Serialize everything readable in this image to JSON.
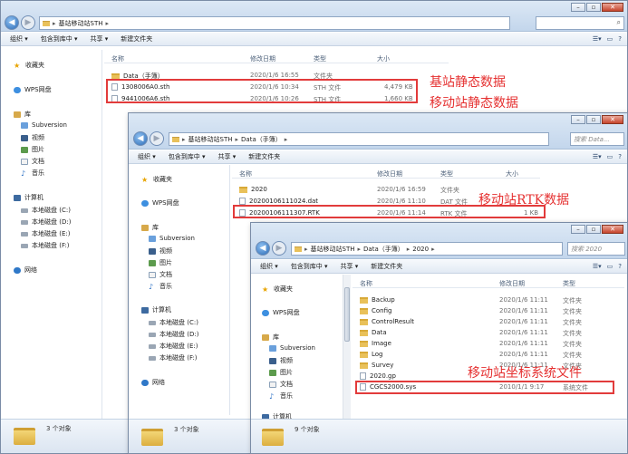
{
  "colors": {
    "annotation": "#e23b3b",
    "accent": "#2c6cb6"
  },
  "window1": {
    "address": [
      "基站移动站STH"
    ],
    "search_placeholder": "",
    "toolbar": {
      "organize": "组织 ▾",
      "include": "包含到库中 ▾",
      "share": "共享 ▾",
      "new_folder": "新建文件夹"
    },
    "columns": {
      "name": "名称",
      "modified": "修改日期",
      "type": "类型",
      "size": "大小"
    },
    "files": [
      {
        "name": "Data（手簿）",
        "date": "2020/1/6 16:55",
        "type": "文件夹",
        "size": "",
        "kind": "folder"
      },
      {
        "name": "1308006A0.sth",
        "date": "2020/1/6 10:34",
        "type": "STH 文件",
        "size": "4,479 KB",
        "kind": "file"
      },
      {
        "name": "9441006A6.sth",
        "date": "2020/1/6 10:26",
        "type": "STH 文件",
        "size": "1,660 KB",
        "kind": "file"
      }
    ],
    "nav": {
      "favorites": "收藏夹",
      "wps": "WPS网盘",
      "library": "库",
      "lib_items": [
        "Subversion",
        "视频",
        "图片",
        "文档",
        "音乐"
      ],
      "computer": "计算机",
      "disks": [
        "本地磁盘 (C:)",
        "本地磁盘 (D:)",
        "本地磁盘 (E:)",
        "本地磁盘 (F:)"
      ],
      "network": "网络"
    },
    "status": "3 个对象"
  },
  "window2": {
    "address": [
      "基站移动站STH",
      "Data（手簿）"
    ],
    "search_placeholder": "搜索 Data...",
    "toolbar": {
      "organize": "组织 ▾",
      "include": "包含到库中 ▾",
      "share": "共享 ▾",
      "new_folder": "新建文件夹"
    },
    "columns": {
      "name": "名称",
      "modified": "修改日期",
      "type": "类型",
      "size": "大小"
    },
    "files": [
      {
        "name": "2020",
        "date": "2020/1/6 16:59",
        "type": "文件夹",
        "size": "",
        "kind": "folder"
      },
      {
        "name": "20200106111024.dat",
        "date": "2020/1/6 11:10",
        "type": "DAT 文件",
        "size": "",
        "kind": "file"
      },
      {
        "name": "20200106111307.RTK",
        "date": "2020/1/6 11:14",
        "type": "RTK 文件",
        "size": "1 KB",
        "kind": "file"
      }
    ],
    "nav": {
      "favorites": "收藏夹",
      "wps": "WPS网盘",
      "library": "库",
      "lib_items": [
        "Subversion",
        "视频",
        "图片",
        "文档",
        "音乐"
      ],
      "computer": "计算机",
      "disks": [
        "本地磁盘 (C:)",
        "本地磁盘 (D:)",
        "本地磁盘 (E:)",
        "本地磁盘 (F:)"
      ],
      "network": "网络"
    },
    "status": "3 个对象"
  },
  "window3": {
    "address": [
      "基站移动站STH",
      "Data（手簿）",
      "2020"
    ],
    "search_placeholder": "搜索 2020",
    "toolbar": {
      "organize": "组织 ▾",
      "include": "包含到库中 ▾",
      "share": "共享 ▾",
      "new_folder": "新建文件夹"
    },
    "columns": {
      "name": "名称",
      "modified": "修改日期",
      "type": "类型"
    },
    "files": [
      {
        "name": "Backup",
        "date": "2020/1/6 11:11",
        "type": "文件夹",
        "kind": "folder"
      },
      {
        "name": "Config",
        "date": "2020/1/6 11:11",
        "type": "文件夹",
        "kind": "folder"
      },
      {
        "name": "ControlResult",
        "date": "2020/1/6 11:11",
        "type": "文件夹",
        "kind": "folder"
      },
      {
        "name": "Data",
        "date": "2020/1/6 11:11",
        "type": "文件夹",
        "kind": "folder"
      },
      {
        "name": "Image",
        "date": "2020/1/6 11:11",
        "type": "文件夹",
        "kind": "folder"
      },
      {
        "name": "Log",
        "date": "2020/1/6 11:11",
        "type": "文件夹",
        "kind": "folder"
      },
      {
        "name": "Survey",
        "date": "2020/1/6 11:11",
        "type": "文件夹",
        "kind": "folder"
      },
      {
        "name": "2020.gp",
        "date": "",
        "type": "",
        "kind": "file"
      },
      {
        "name": "CGCS2000.sys",
        "date": "2010/1/1 9:17",
        "type": "系统文件",
        "kind": "file"
      }
    ],
    "nav": {
      "favorites": "收藏夹",
      "wps": "WPS网盘",
      "library": "库",
      "lib_items": [
        "Subversion",
        "视频",
        "图片",
        "文档",
        "音乐"
      ],
      "computer": "计算机"
    },
    "status": "9 个对象"
  },
  "annotations": {
    "base_static": "基站静态数据",
    "rover_static": "移动站静态数据",
    "rover_rtk": "移动站RTK数据",
    "rover_coord": "移动站坐标系统文件"
  }
}
